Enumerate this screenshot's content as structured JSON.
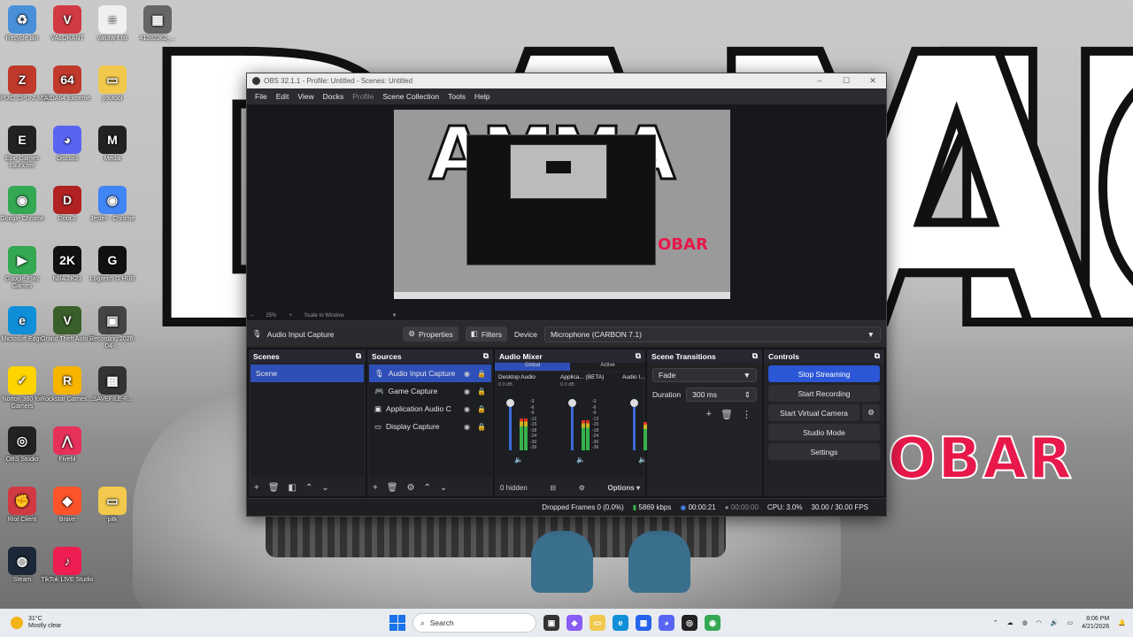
{
  "desktop": {
    "icons": [
      {
        "label": "Recycle Bin",
        "glyph": "♻",
        "color": "#4a90d9"
      },
      {
        "label": "VALORANT",
        "glyph": "V",
        "color": "#d13a42"
      },
      {
        "label": "valorant.txt",
        "glyph": "≡",
        "color": "#f0f0f0"
      },
      {
        "label": "41082362_...",
        "glyph": "▦",
        "color": "#666666"
      },
      {
        "label": "CPUID CPU-Z MSI",
        "glyph": "Z",
        "color": "#c0392b"
      },
      {
        "label": "AIDA64 Extreme",
        "glyph": "64",
        "color": "#c0392b"
      },
      {
        "label": "youtool",
        "glyph": "▭",
        "color": "#f2c94c"
      },
      {
        "label": "Epic Games Launcher",
        "glyph": "E",
        "color": "#222222"
      },
      {
        "label": "Discord",
        "glyph": "◕",
        "color": "#5865f2"
      },
      {
        "label": "Medal",
        "glyph": "M",
        "color": "#222222"
      },
      {
        "label": "Google Chrome",
        "glyph": "◉",
        "color": "#34a853"
      },
      {
        "label": "Dota 2",
        "glyph": "D",
        "color": "#b22222"
      },
      {
        "label": "Jester - Chrome",
        "glyph": "◉",
        "color": "#4285f4"
      },
      {
        "label": "NBA 2K21",
        "glyph": "2K",
        "color": "#111111"
      },
      {
        "label": "Logitech G HUB",
        "glyph": "G",
        "color": "#111111"
      },
      {
        "label": "Google Play Games",
        "glyph": "▶",
        "color": "#34a853"
      },
      {
        "label": "Microsoft Edge",
        "glyph": "e",
        "color": "#0f8fd8"
      },
      {
        "label": "Grand Theft Auto V",
        "glyph": "V",
        "color": "#3a5f2a"
      },
      {
        "label": "Recording 2026-04-...",
        "glyph": "▣",
        "color": "#444444"
      },
      {
        "label": "Norton 360 for Gamers",
        "glyph": "✓",
        "color": "#ffd400"
      },
      {
        "label": "Rockstar Games ...",
        "glyph": "R",
        "color": "#f7b500"
      },
      {
        "label": "SAVEFILE-F...",
        "glyph": "▩",
        "color": "#333333"
      },
      {
        "label": "OBS Studio",
        "glyph": "◎",
        "color": "#222222"
      },
      {
        "label": "FiveM",
        "glyph": "⋀",
        "color": "#e6315a"
      },
      {
        "label": "Riot Client",
        "glyph": "✊",
        "color": "#d13a42"
      },
      {
        "label": "Brave",
        "glyph": "◆",
        "color": "#fb542b"
      },
      {
        "label": "pitk",
        "glyph": "▭",
        "color": "#f2c94c"
      },
      {
        "label": "Steam",
        "glyph": "◍",
        "color": "#1b2838"
      },
      {
        "label": "TikTok LIVE Studio",
        "glyph": "♪",
        "color": "#ee1d52"
      }
    ],
    "wallpaper_text_left": "DAMMA",
    "wallpaper_text_right": "AG",
    "wallpaper_obar": "OBAR"
  },
  "obs": {
    "title": "OBS 32.1.1 - Profile: Untitled - Scenes: Untitled",
    "menu": [
      "File",
      "Edit",
      "View",
      "Docks",
      "Profile",
      "Scene Collection",
      "Tools",
      "Help"
    ],
    "preview": {
      "zoom": "25%",
      "scale": "Scale to Window",
      "inner_obar": "OBAR",
      "inner_big": "AMMA"
    },
    "source_toolbar": {
      "source_name": "Audio Input Capture",
      "properties": "Properties",
      "filters": "Filters",
      "device_label": "Device",
      "device_value": "Microphone (CARBON 7.1)"
    },
    "scenes": {
      "title": "Scenes",
      "items": [
        "Scene"
      ]
    },
    "sources": {
      "title": "Sources",
      "items": [
        "Audio Input Capture",
        "Game Capture",
        "Application Audio C",
        "Display Capture"
      ]
    },
    "mixer": {
      "title": "Audio Mixer",
      "tabs": [
        "Global",
        "Active"
      ],
      "channels": [
        {
          "name": "Desktop Audio",
          "db": "0.0 dB",
          "level": 0.62
        },
        {
          "name": "Applica... (BETA)",
          "db": "0.0 dB",
          "level": 0.58
        },
        {
          "name": "Audio I...",
          "db": "",
          "level": 0.55
        }
      ],
      "ticks": [
        "-3",
        "-6",
        "-9",
        "-12",
        "-15",
        "-18",
        "-24",
        "-30",
        "-36",
        "-42",
        "-48",
        "-54",
        "-60"
      ],
      "hidden": "0 hidden",
      "options": "Options"
    },
    "transitions": {
      "title": "Scene Transitions",
      "type": "Fade",
      "duration_label": "Duration",
      "duration_value": "300 ms"
    },
    "controls": {
      "title": "Controls",
      "buttons": [
        "Stop Streaming",
        "Start Recording",
        "Start Virtual Camera",
        "Studio Mode",
        "Settings"
      ]
    },
    "status": {
      "dropped": "Dropped Frames 0 (0.0%)",
      "kbps": "5869 kbps",
      "stream_time": "00:00:21",
      "rec_time": "00:00:00",
      "cpu": "CPU: 3.0%",
      "fps": "30.00 / 30.00 FPS"
    }
  },
  "taskbar": {
    "weather_temp": "31°C",
    "weather_desc": "Mostly clear",
    "search_placeholder": "Search",
    "time": "8:06 PM",
    "date": "4/21/2026"
  },
  "colors": {
    "accent": "#2b56d6",
    "selection": "#2f4fb8",
    "obar_red": "#e8184a"
  }
}
